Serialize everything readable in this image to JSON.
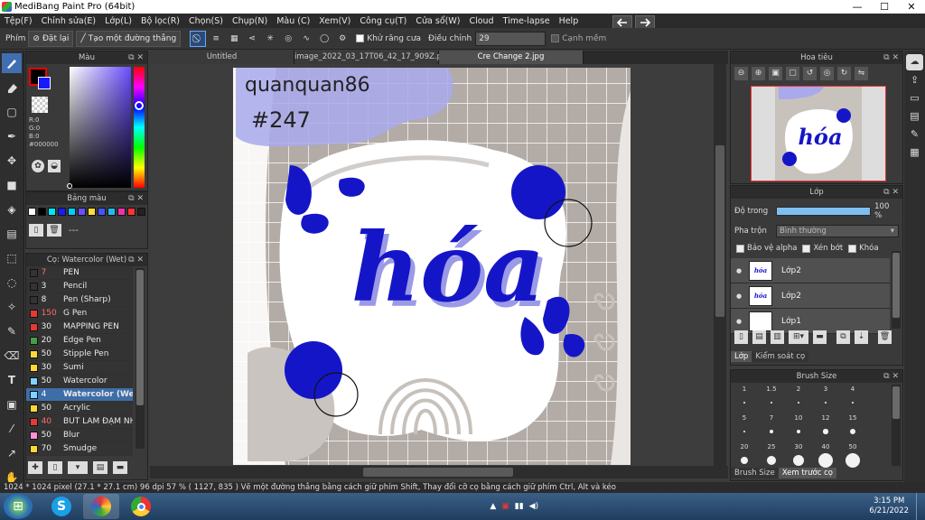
{
  "window": {
    "title": "MediBang Paint Pro (64bit)",
    "controls": [
      "—",
      "☐",
      "✕"
    ]
  },
  "menu": [
    "Tệp(F)",
    "Chỉnh sửa(E)",
    "Lớp(L)",
    "Bộ lọc(R)",
    "Chọn(S)",
    "Chụp(N)",
    "Màu (C)",
    "Xem(V)",
    "Công cụ(T)",
    "Cửa sổ(W)",
    "Cloud",
    "Time-lapse",
    "Help"
  ],
  "toolbar": {
    "label": "Phím",
    "reset": "Đặt lại",
    "make_line": "Tạo một đường thẳng",
    "antialias": "Khử răng cưa",
    "adjust_label": "Điều chỉnh",
    "adjust_value": "29",
    "snap": "Cạnh mềm"
  },
  "color_panel": {
    "title": "Màu",
    "r": "R:0",
    "g": "G:0",
    "b": "B:0",
    "hex": "#000000"
  },
  "palette_panel": {
    "title": "Bảng màu",
    "swatches": [
      "#ffffff",
      "#000000",
      "#00e5ff",
      "#1a1aff",
      "#00ccff",
      "#6b4fff",
      "#ffdd33",
      "#4455ff",
      "#22bbee",
      "#ee33aa",
      "#ff3333",
      "#222222"
    ],
    "status": "---"
  },
  "brush_panel": {
    "title": "Cọ: Watercolor (Wet)",
    "items": [
      {
        "size": "7",
        "name": "PEN",
        "color": "#333333",
        "size_color": "#ff6b6b"
      },
      {
        "size": "3",
        "name": "Pencil",
        "color": "#333333",
        "size_color": "#eeeeee"
      },
      {
        "size": "8",
        "name": "Pen (Sharp)",
        "color": "#333333",
        "size_color": "#eeeeee"
      },
      {
        "size": "150",
        "name": "G Pen",
        "color": "#e53935",
        "size_color": "#ff6b6b"
      },
      {
        "size": "30",
        "name": "MAPPING PEN",
        "color": "#e53935",
        "size_color": "#eeeeee"
      },
      {
        "size": "20",
        "name": "Edge Pen",
        "color": "#43a047",
        "size_color": "#eeeeee"
      },
      {
        "size": "50",
        "name": "Stipple Pen",
        "color": "#fdd835",
        "size_color": "#eeeeee"
      },
      {
        "size": "30",
        "name": "Sumi",
        "color": "#fdd835",
        "size_color": "#eeeeee"
      },
      {
        "size": "50",
        "name": "Watercolor",
        "color": "#7fd3ff",
        "size_color": "#eeeeee"
      },
      {
        "size": "4",
        "name": "Watercolor (Wet)",
        "color": "#7fd3ff",
        "size_color": "#ff6b6b"
      },
      {
        "size": "50",
        "name": "Acrylic",
        "color": "#fdd835",
        "size_color": "#eeeeee"
      },
      {
        "size": "40",
        "name": "BÚT LÀM ĐẠM NHẠ",
        "color": "#e53935",
        "size_color": "#ff6b6b"
      },
      {
        "size": "50",
        "name": "Blur",
        "color": "#ff8fd0",
        "size_color": "#eeeeee"
      },
      {
        "size": "70",
        "name": "Smudge",
        "color": "#fdd835",
        "size_color": "#eeeeee"
      }
    ],
    "selected_index": 9
  },
  "tabs": [
    {
      "label": "Untitled",
      "active": false
    },
    {
      "label": "image_2022_03_17T06_42_17_909Z.png",
      "active": false
    },
    {
      "label": "Cre Change 2.jpg",
      "active": true
    }
  ],
  "artwork": {
    "handwriting_top": "quanquan86",
    "handwriting_tag": "#247",
    "title": "hóa",
    "blue": "#1515c8",
    "purple": "#9a9ae6"
  },
  "navigator_panel": {
    "title": "Hoa tiêu"
  },
  "layer_panel": {
    "title": "Lớp",
    "opacity_label": "Độ trong",
    "opacity_value": "100 %",
    "blend_label": "Pha trộn",
    "blend_value": "Bình thường",
    "protect_alpha": "Bảo vệ alpha",
    "clip": "Xén bớt",
    "lock": "Khóa",
    "layers": [
      {
        "name": "Lớp2",
        "thumb": "hóa"
      },
      {
        "name": "Lớp2",
        "thumb": "hóa"
      },
      {
        "name": "Lớp1",
        "thumb": ""
      }
    ],
    "tab_layer": "Lớp",
    "tab_brush_control": "Kiểm soát cọ"
  },
  "brush_size_panel": {
    "title": "Brush Size",
    "sizes": [
      "1",
      "1.5",
      "2",
      "3",
      "4",
      "5",
      "7",
      "10",
      "12",
      "15",
      "20",
      "25",
      "30",
      "40",
      "50"
    ],
    "tab_size": "Brush Size",
    "tab_preview": "Xem trước cọ"
  },
  "status": {
    "text": "1024 * 1024 pixel   (27.1 * 27.1 cm)   96 dpi   57 %   ( 1127, 835 )   Vẽ một đường thẳng bằng cách giữ phím Shift, Thay đổi cỡ cọ bằng cách giữ phím Ctrl, Alt và kéo"
  },
  "taskbar": {
    "time": "3:15 PM",
    "date": "6/21/2022"
  }
}
